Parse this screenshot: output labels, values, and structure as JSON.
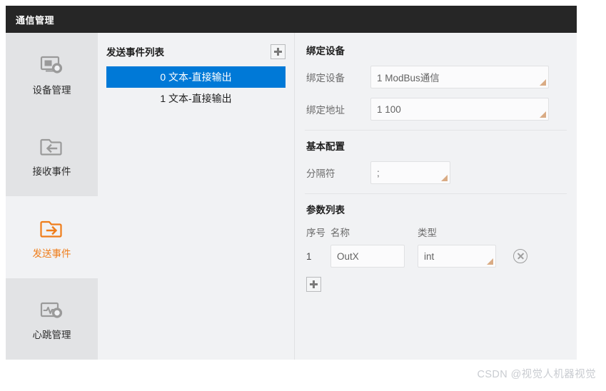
{
  "window": {
    "title": "通信管理"
  },
  "sidebar": {
    "items": [
      {
        "label": "设备管理",
        "icon": "monitor-gear-icon",
        "active": false
      },
      {
        "label": "接收事件",
        "icon": "folder-in-arrow-icon",
        "active": false
      },
      {
        "label": "发送事件",
        "icon": "folder-out-arrow-icon",
        "active": true
      },
      {
        "label": "心跳管理",
        "icon": "heartbeat-gear-icon",
        "active": false
      }
    ]
  },
  "list_panel": {
    "title": "发送事件列表",
    "add_button_icon": "plus-icon",
    "items": [
      {
        "label": "0 文本-直接输出",
        "selected": true
      },
      {
        "label": "1 文本-直接输出",
        "selected": false
      }
    ]
  },
  "detail": {
    "bind_section": {
      "title": "绑定设备",
      "fields": [
        {
          "label": "绑定设备",
          "value": "1 ModBus通信"
        },
        {
          "label": "绑定地址",
          "value": "1 100"
        }
      ]
    },
    "basic_section": {
      "title": "基本配置",
      "fields": [
        {
          "label": "分隔符",
          "value": ";"
        }
      ]
    },
    "param_section": {
      "title": "参数列表",
      "columns": {
        "index": "序号",
        "name": "名称",
        "type": "类型"
      },
      "rows": [
        {
          "index": "1",
          "name": "OutX",
          "type": "int",
          "delete_icon": "circle-x-icon"
        }
      ],
      "add_button_icon": "plus-icon"
    }
  },
  "watermark": "CSDN @视觉人机器视觉",
  "colors": {
    "titlebar_bg": "#262626",
    "panel_bg": "#f1f2f4",
    "sidebar_item_bg": "#e2e3e5",
    "accent": "#ef7d1a",
    "selection": "#0079d7",
    "combo_handle": "#d9ab84"
  }
}
